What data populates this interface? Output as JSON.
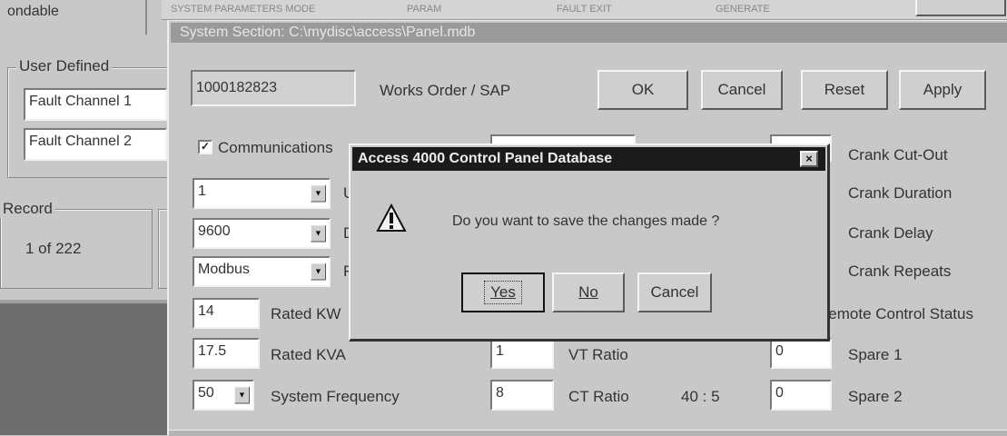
{
  "background": {
    "top_left_label": "ondable",
    "top_strip_text_1": "SYSTEM PARAMETERS MODE",
    "top_strip_text_2": "PARAM",
    "top_strip_text_3": "FAULT EXIT",
    "top_strip_text_4": "GENERATE",
    "user_defined_group": "User Defined",
    "fault_channel_1": "Fault Channel 1",
    "fault_channel_2": "Fault Channel 2",
    "record_group": "Record",
    "record_value": "1 of 222"
  },
  "window": {
    "title": "System Section: C:\\mydisc\\access\\Panel.mdb"
  },
  "form": {
    "works_order_value": "1000182823",
    "works_order_label": "Works Order / SAP",
    "ok_label": "OK",
    "cancel_label": "Cancel",
    "reset_label": "Reset",
    "apply_label": "Apply",
    "communications_label": "Communications",
    "communications_checked": true,
    "combo_1_value": "1",
    "combo_2_value": "9600",
    "combo_3_value": "Modbus",
    "rated_kw_value": "14",
    "rated_kw_label": "Rated KW",
    "rated_kva_value": "17.5",
    "rated_kva_label": "Rated KVA",
    "frequency_value": "50",
    "frequency_label": "System Frequency",
    "vt_ratio_value": "1",
    "vt_ratio_label": "VT Ratio",
    "ct_ratio_value": "8",
    "ct_ratio_label": "CT Ratio",
    "ct_ratio_display": "40 : 5",
    "spare1_value": "0",
    "spare1_label": "Spare 1",
    "spare2_value": "0",
    "spare2_label": "Spare 2",
    "crank_cutout_label": "Crank Cut-Out",
    "crank_duration_label": "Crank Duration",
    "crank_delay_label": "Crank Delay",
    "crank_repeats_label": "Crank Repeats",
    "control_status_label": "Remote Control Status"
  },
  "dialog": {
    "title": "Access 4000 Control Panel Database",
    "icon": "warning-icon",
    "message": "Do you want to save the changes made ?",
    "yes_label": "Yes",
    "no_label": "No",
    "cancel_label": "Cancel",
    "close_icon": "close-icon"
  },
  "colors": {
    "title_bar_active": "#1b1b1b",
    "title_bar_inactive": "#9a9a9a",
    "dark_backdrop": "#6e6e6e"
  }
}
